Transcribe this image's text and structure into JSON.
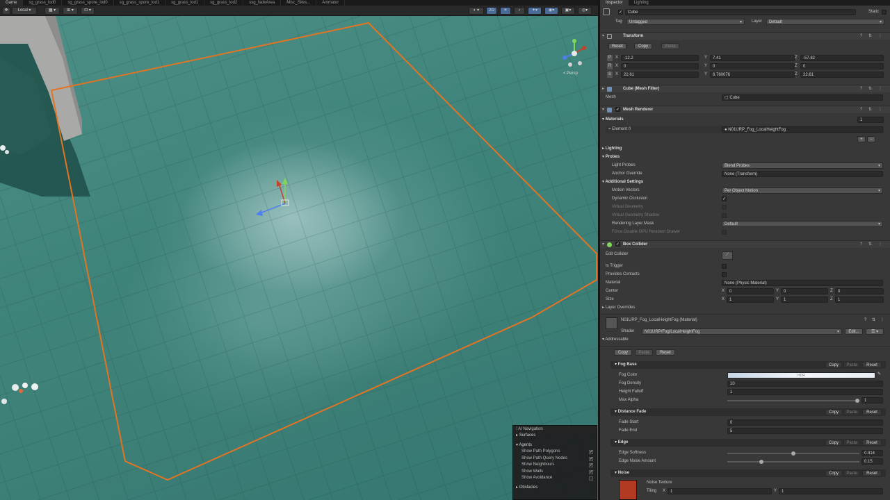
{
  "scene_tabs": [
    "Game",
    "sg_grass_lod0",
    "sg_grass_spore_lod0",
    "sg_grass_spore_lod1",
    "sg_grass_lod1",
    "sg_grass_lod2",
    "ssg_fadeArea",
    "Misc_Sites...",
    "Animator"
  ],
  "scene_toolbar": {
    "pivot": "Local",
    "mode_2d": "2D",
    "ui_colors": {
      "accent": "#4a6a9a"
    }
  },
  "scene": {
    "gizmo_label": "< Persp",
    "selection_color": "#e27423",
    "navigation": {
      "title": "AI Navigation",
      "surfaces": "Surfaces",
      "agents": "Agents",
      "items": [
        {
          "label": "Show Path Polygons",
          "checked": true
        },
        {
          "label": "Show Path Query Nodes",
          "checked": true
        },
        {
          "label": "Show Neighbours",
          "checked": true
        },
        {
          "label": "Show Walls",
          "checked": true
        },
        {
          "label": "Show Avoidance",
          "checked": false
        }
      ],
      "obstacles": "Obstacles"
    }
  },
  "inspector": {
    "tabs": [
      "Inspector",
      "Lighting"
    ],
    "object_name": "Cube",
    "static_label": "Static",
    "tag_label": "Tag",
    "tag_value": "Untagged",
    "layer_label": "Layer",
    "layer_value": "Default",
    "transform": {
      "title": "Transform",
      "buttons": [
        "Reset",
        "Copy",
        "Paste"
      ],
      "rows": [
        {
          "label": "P",
          "x": "-12.2",
          "y": "7.41",
          "z": "-57.82"
        },
        {
          "label": "R",
          "x": "0",
          "y": "0",
          "z": "0"
        },
        {
          "label": "S",
          "x": "22.61",
          "y": "6.760076",
          "z": "22.61"
        }
      ]
    },
    "mesh_filter": {
      "title": "Cube (Mesh Filter)",
      "mesh_label": "Mesh",
      "mesh_value": "Cube"
    },
    "mesh_renderer": {
      "title": "Mesh Renderer",
      "materials_label": "Materials",
      "materials_count": "1",
      "element_label": "Element 0",
      "element_value": "N01URP_Fog_LocalHeightFog",
      "lighting_label": "Lighting",
      "probes_label": "Probes",
      "light_probes_label": "Light Probes",
      "light_probes_value": "Blend Probes",
      "anchor_label": "Anchor Override",
      "anchor_value": "None (Transform)",
      "additional_label": "Additional Settings",
      "motion_label": "Motion Vectors",
      "motion_value": "Per Object Motion",
      "dynamic_occlusion_label": "Dynamic Occlusion",
      "virtual_geometry_label": "Virtual Geometry",
      "virtual_shadow_label": "Virtual Geometry Shadow",
      "rendering_layer_label": "Rendering Layer Mask",
      "rendering_layer_value": "Default",
      "force_disable_label": "Force Disable GPU Resident Drawer"
    },
    "box_collider": {
      "title": "Box Collider",
      "edit_label": "Edit Collider",
      "trigger_label": "Is Trigger",
      "contacts_label": "Provides Contacts",
      "material_label": "Material",
      "material_value": "None (Physic Material)",
      "center_label": "Center",
      "center": {
        "x": "0",
        "y": "0",
        "z": "0"
      },
      "size_label": "Size",
      "size": {
        "x": "1",
        "y": "1",
        "z": "1"
      },
      "layer_overrides": "Layer Overrides"
    },
    "material": {
      "title": "N01URP_Fog_LocalHeightFog (Material)",
      "shader_label": "Shader",
      "shader_value": "N01URP/Fog/LocalHeightFog",
      "edit_label": "Edit...",
      "addressable": "Addressable",
      "buttons": [
        "Copy",
        "Paste",
        "Reset"
      ],
      "sections": {
        "fog_base": {
          "title": "Fog Base",
          "fog_color_label": "Fog Color",
          "fog_color_hdr": "HDR",
          "fog_density_label": "Fog Density",
          "fog_density_value": "10",
          "height_falloff_label": "Height Falloff",
          "height_falloff_value": "1",
          "max_alpha_label": "Max Alpha",
          "max_alpha_value": "1",
          "max_alpha_fraction": 1.0
        },
        "distance_fade": {
          "title": "Distance Fade",
          "fade_start_label": "Fade Start",
          "fade_start_value": "0",
          "fade_end_label": "Fade End",
          "fade_end_value": "5"
        },
        "edge": {
          "title": "Edge",
          "softness_label": "Edge Softness",
          "softness_value": "0.314",
          "softness_fraction": 0.5,
          "noise_label": "Edge Noise Amount",
          "noise_value": "0.15",
          "noise_fraction": 0.25
        },
        "noise": {
          "title": "Noise",
          "texture_label": "Noise Texture",
          "tiling_label": "Tiling",
          "tiling_x": "1",
          "tiling_y": "1",
          "swatch_color": "#b23a24"
        }
      }
    }
  }
}
